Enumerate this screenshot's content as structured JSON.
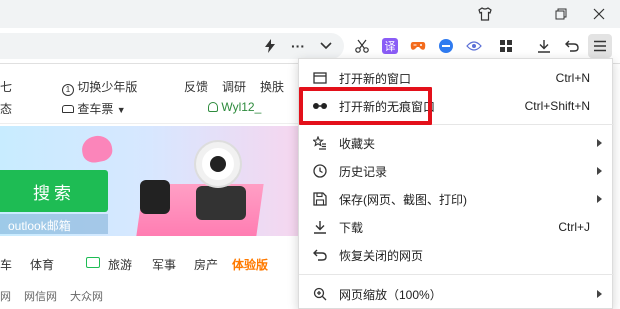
{
  "window": {
    "icons": [
      "shirt-icon",
      "restore-icon",
      "close-icon"
    ]
  },
  "toolbar": {
    "icons": [
      "lightning-icon",
      "more-icon",
      "chevron-down-icon",
      "scissors-icon",
      "translate-icon",
      "game-icon",
      "chat-icon",
      "eye-icon",
      "grid-icon",
      "download-icon",
      "undo-icon",
      "menu-icon"
    ],
    "translate_label": "译"
  },
  "page": {
    "top_links": {
      "row1_left_partial": "七",
      "row2_left_partial": "态",
      "teen_mode": "切换少年版",
      "car_market": "查车票",
      "feedback": "反馈",
      "survey": "调研",
      "skin": "换肤",
      "username": "Wyl12_"
    },
    "search_button": "搜索",
    "outlook_label": "outlook邮箱",
    "nav": [
      "车",
      "体育",
      "旅游",
      "军事",
      "房产",
      "体验版"
    ],
    "bottom_links": [
      "网",
      "网信网",
      "大众网"
    ]
  },
  "menu": {
    "items": [
      {
        "icon": "window-icon",
        "label": "打开新的窗口",
        "shortcut": "Ctrl+N",
        "submenu": false
      },
      {
        "icon": "incognito-icon",
        "label": "打开新的无痕窗口",
        "shortcut": "Ctrl+Shift+N",
        "submenu": false
      },
      {
        "icon": "star-list-icon",
        "label": "收藏夹",
        "shortcut": "",
        "submenu": true
      },
      {
        "icon": "clock-icon",
        "label": "历史记录",
        "shortcut": "",
        "submenu": true
      },
      {
        "icon": "save-icon",
        "label": "保存(网页、截图、打印)",
        "shortcut": "",
        "submenu": true
      },
      {
        "icon": "download-icon",
        "label": "下载",
        "shortcut": "Ctrl+J",
        "submenu": false
      },
      {
        "icon": "restore-tab-icon",
        "label": "恢复关闭的网页",
        "shortcut": "",
        "submenu": false
      },
      {
        "icon": "zoom-icon",
        "label": "网页缩放（100%）",
        "shortcut": "",
        "submenu": true
      }
    ]
  },
  "colors": {
    "highlight": "#e3101a",
    "search_green": "#1ebc54",
    "username_green": "#2e8b3d",
    "accent_orange": "#ff7a00"
  }
}
